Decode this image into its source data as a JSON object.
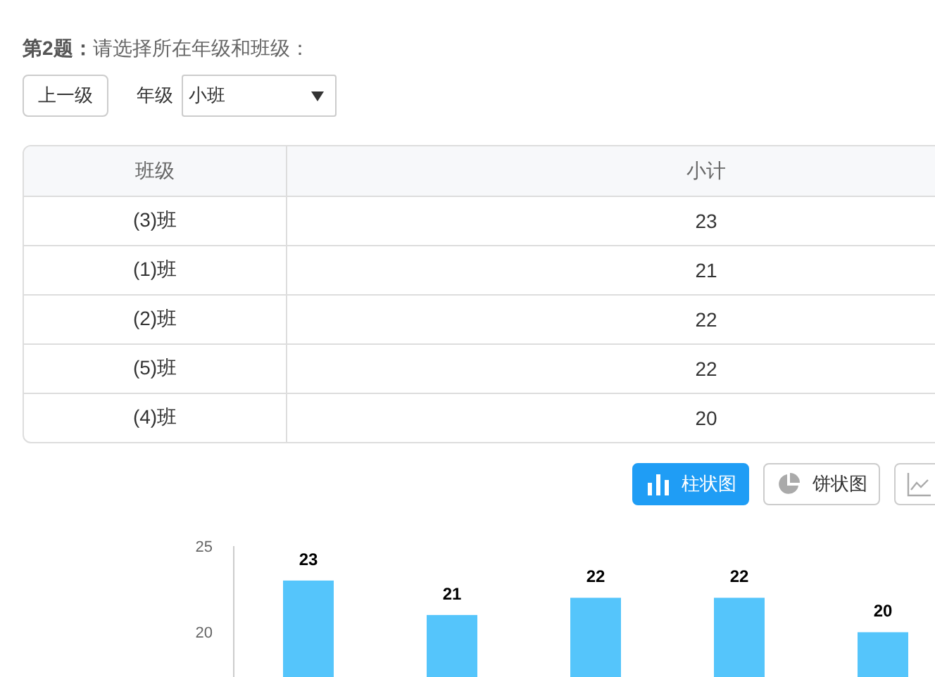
{
  "question": "**第2题：**请选择所在年级和班级：",
  "back_button": "上一级",
  "grade_filter": {
    "label": "年级",
    "value": "小班"
  },
  "table": {
    "columns": [
      "班级",
      "小计"
    ],
    "rows": [
      [
        "(3)班",
        "23"
      ],
      [
        "(1)班",
        "21"
      ],
      [
        "(2)班",
        "22"
      ],
      [
        "(5)班",
        "22"
      ],
      [
        "(4)班",
        "20"
      ]
    ]
  },
  "chart_buttons": [
    {
      "kind": "bar",
      "label": "柱状图",
      "selected": true
    },
    {
      "kind": "pie",
      "label": "饼状图",
      "selected": false
    },
    {
      "kind": "line",
      "selected": false
    }
  ],
  "chart": {
    "chart_data": {
      "type": "bar",
      "categories": [
        null,
        null,
        null,
        null,
        null
      ],
      "ylim": [
        17.4,
        25
      ],
      "yticks": [
        20,
        25
      ],
      "data_labels": true,
      "series": [
        {
          "color": "#55c5fb",
          "values": [
            23,
            21,
            22,
            22,
            20
          ]
        }
      ]
    }
  }
}
